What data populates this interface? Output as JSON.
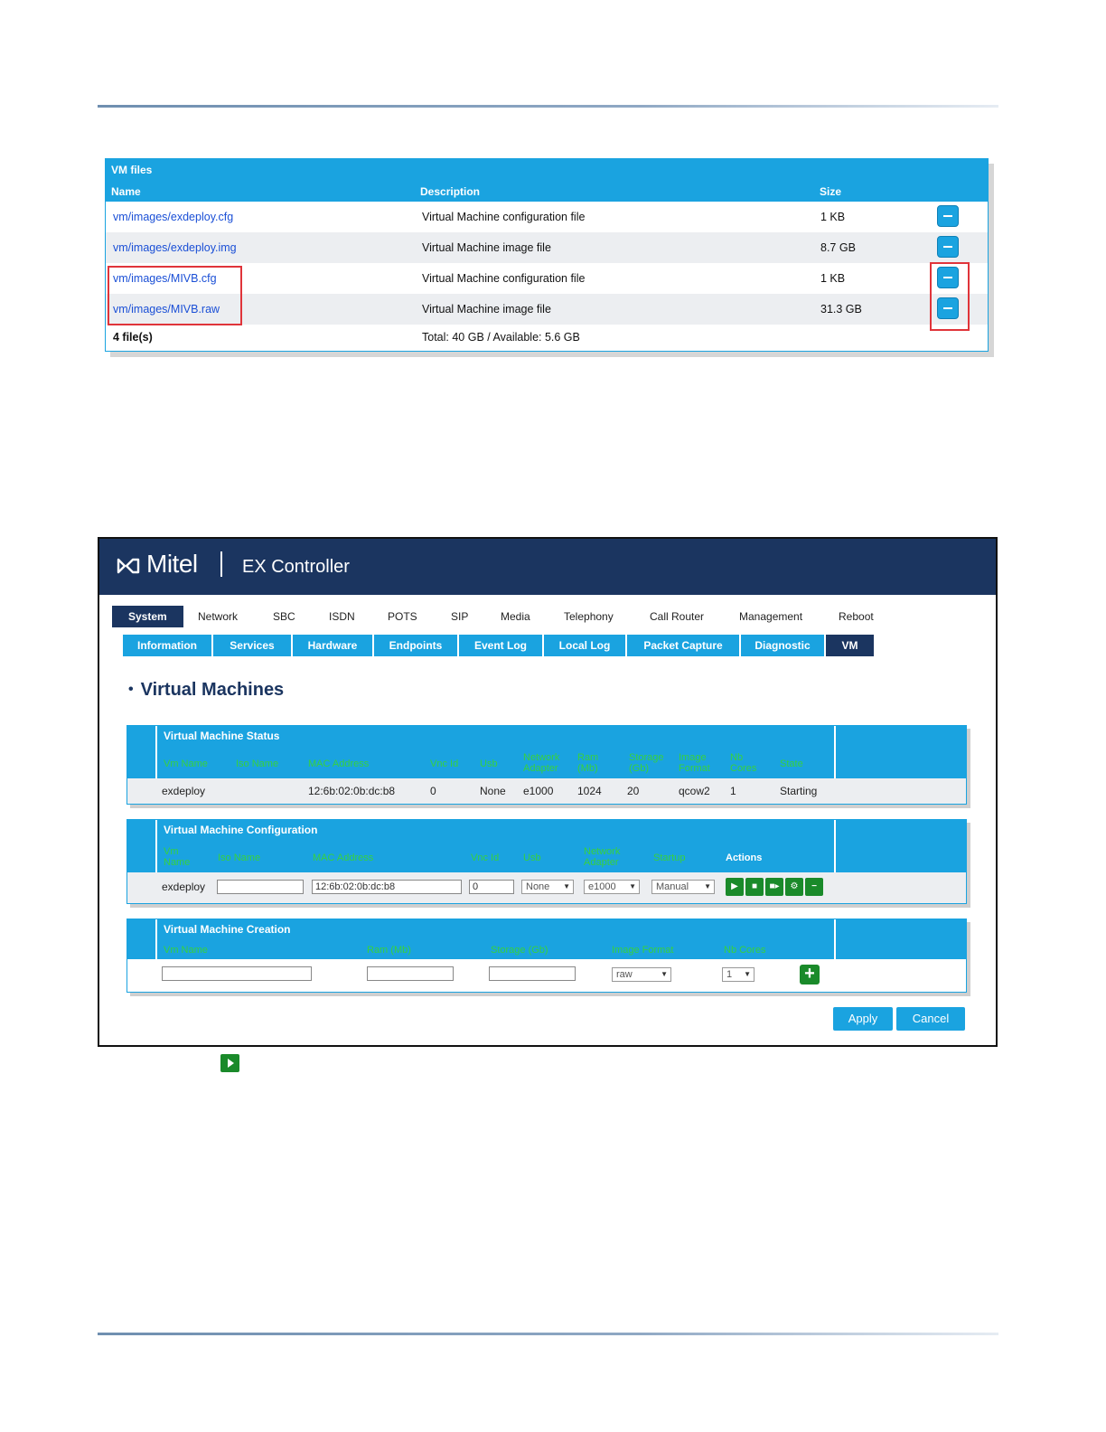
{
  "vm_files": {
    "title": "VM files",
    "columns": {
      "name": "Name",
      "description": "Description",
      "size": "Size"
    },
    "rows": [
      {
        "name": "vm/images/exdeploy.cfg",
        "description": "Virtual Machine configuration file",
        "size": "1 KB"
      },
      {
        "name": "vm/images/exdeploy.img",
        "description": "Virtual Machine image file",
        "size": "8.7 GB"
      },
      {
        "name": "vm/images/MIVB.cfg",
        "description": "Virtual Machine configuration file",
        "size": "1 KB"
      },
      {
        "name": "vm/images/MIVB.raw",
        "description": "Virtual Machine image file",
        "size": "31.3 GB"
      }
    ],
    "footer": {
      "count": "4 file(s)",
      "total": "Total: 40 GB / Available: 5.6 GB"
    },
    "highlight_color": "#e0343a"
  },
  "controller": {
    "brand": "Mitel",
    "product": "EX Controller",
    "main_tabs": [
      "System",
      "Network",
      "SBC",
      "ISDN",
      "POTS",
      "SIP",
      "Media",
      "Telephony",
      "Call Router",
      "Management",
      "Reboot"
    ],
    "active_main_tab": "System",
    "sub_tabs": [
      "Information",
      "Services",
      "Hardware",
      "Endpoints",
      "Event Log",
      "Local Log",
      "Packet Capture",
      "Diagnostic",
      "VM"
    ],
    "active_sub_tab": "VM",
    "heading": "Virtual Machines",
    "status": {
      "title": "Virtual Machine Status",
      "columns": [
        "Vm Name",
        "Iso Name",
        "MAC Address",
        "Vnc Id",
        "Usb",
        "Network Adapter",
        "Ram (Mb)",
        "Storage (Gb)",
        "Image Format",
        "Nb Cores",
        "State"
      ],
      "row": {
        "vm_name": "exdeploy",
        "iso_name": "",
        "mac": "12:6b:02:0b:dc:b8",
        "vnc_id": "0",
        "usb": "None",
        "network_adapter": "e1000",
        "ram": "1024",
        "storage": "20",
        "image_format": "qcow2",
        "nb_cores": "1",
        "state": "Starting"
      }
    },
    "configuration": {
      "title": "Virtual Machine Configuration",
      "columns": [
        "Vm Name",
        "Iso Name",
        "MAC Address",
        "Vnc Id",
        "Usb",
        "Network Adapter",
        "Startup",
        "Actions"
      ],
      "row": {
        "vm_name": "exdeploy",
        "iso_name": "",
        "mac": "12:6b:02:0b:dc:b8",
        "vnc_id": "0",
        "usb": "None",
        "network_adapter": "e1000",
        "startup": "Manual"
      },
      "actions": [
        "play-icon",
        "stop-icon",
        "restart-icon",
        "settings-icon",
        "minus-icon"
      ]
    },
    "creation": {
      "title": "Virtual Machine Creation",
      "columns": [
        "Vm Name",
        "Ram (Mb)",
        "Storage (Gb)",
        "Image Format",
        "Nb Cores"
      ],
      "row": {
        "vm_name": "",
        "ram": "",
        "storage": "",
        "image_format": "raw",
        "nb_cores": "1"
      }
    },
    "apply_label": "Apply",
    "cancel_label": "Cancel"
  },
  "colors": {
    "banner": "#1b3560",
    "accent": "#1aa3e0",
    "column_text": "#37d13f",
    "action_green": "#1a8a2a",
    "link": "#1a4fd6"
  }
}
